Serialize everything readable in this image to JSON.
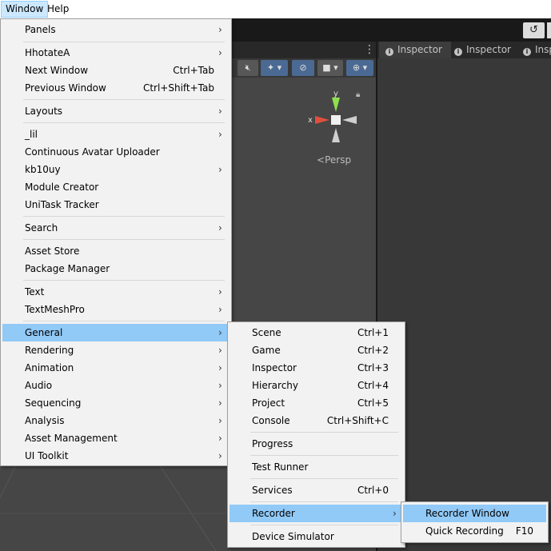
{
  "menubar": {
    "window": "Window",
    "help": "Help"
  },
  "toolbar": {
    "history_icon": "history-icon"
  },
  "scene": {
    "persp_label": "Persp",
    "axis_x": "x",
    "axis_y": "y"
  },
  "inspector_tabs": [
    {
      "label": "Inspector"
    },
    {
      "label": "Inspector"
    },
    {
      "label": "Insp"
    }
  ],
  "window_menu": [
    {
      "label": "Panels",
      "submenu": true
    },
    {
      "label": "HhotateA",
      "submenu": true
    },
    {
      "label": "Next Window",
      "shortcut": "Ctrl+Tab"
    },
    {
      "label": "Previous Window",
      "shortcut": "Ctrl+Shift+Tab"
    },
    {
      "label": "Layouts",
      "submenu": true
    },
    {
      "label": "_lil",
      "submenu": true
    },
    {
      "label": "Continuous Avatar Uploader"
    },
    {
      "label": "kb10uy",
      "submenu": true
    },
    {
      "label": "Module Creator"
    },
    {
      "label": "UniTask Tracker"
    },
    {
      "label": "Search",
      "submenu": true
    },
    {
      "label": "Asset Store"
    },
    {
      "label": "Package Manager"
    },
    {
      "label": "Text",
      "submenu": true
    },
    {
      "label": "TextMeshPro",
      "submenu": true
    },
    {
      "label": "General",
      "submenu": true,
      "highlighted": true
    },
    {
      "label": "Rendering",
      "submenu": true
    },
    {
      "label": "Animation",
      "submenu": true
    },
    {
      "label": "Audio",
      "submenu": true
    },
    {
      "label": "Sequencing",
      "submenu": true
    },
    {
      "label": "Analysis",
      "submenu": true
    },
    {
      "label": "Asset Management",
      "submenu": true
    },
    {
      "label": "UI Toolkit",
      "submenu": true
    }
  ],
  "general_menu": [
    {
      "label": "Scene",
      "shortcut": "Ctrl+1"
    },
    {
      "label": "Game",
      "shortcut": "Ctrl+2"
    },
    {
      "label": "Inspector",
      "shortcut": "Ctrl+3"
    },
    {
      "label": "Hierarchy",
      "shortcut": "Ctrl+4"
    },
    {
      "label": "Project",
      "shortcut": "Ctrl+5"
    },
    {
      "label": "Console",
      "shortcut": "Ctrl+Shift+C"
    },
    {
      "label": "Progress"
    },
    {
      "label": "Test Runner"
    },
    {
      "label": "Services",
      "shortcut": "Ctrl+0"
    },
    {
      "label": "Recorder",
      "submenu": true,
      "highlighted": true
    },
    {
      "label": "Device Simulator"
    }
  ],
  "recorder_menu": [
    {
      "label": "Recorder Window",
      "highlighted": true
    },
    {
      "label": "Quick Recording",
      "shortcut": "F10"
    }
  ],
  "colors": {
    "highlight": "#91c9f7",
    "menu_bg": "#f2f2f2",
    "editor_bg": "#191919"
  }
}
